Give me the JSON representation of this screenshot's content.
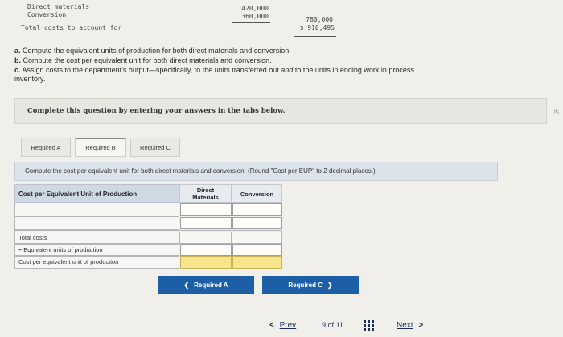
{
  "cost_summary": {
    "direct_materials_label": "Direct materials",
    "direct_materials_value": "420,000",
    "conversion_label": "Conversion",
    "conversion_value": "360,000",
    "subtotal_value": "780,000",
    "total_label": "Total costs to account for",
    "total_value": "$ 910,495"
  },
  "instructions": {
    "a_prefix": "a.",
    "a_text": "Compute the equivalent units of production for both direct materials and conversion.",
    "b_prefix": "b.",
    "b_text": "Compute the cost per equivalent unit for both direct materials and conversion.",
    "c_prefix": "c.",
    "c_text_1": "Assign costs to the department's output—specifically, to the units transferred out",
    "c_and": "and",
    "c_text_2": "to the units in ending work in process",
    "c_text_3": "inventory."
  },
  "complete_text": "Complete this question by entering your answers in the tabs below.",
  "tabs": [
    {
      "label": "Required A"
    },
    {
      "label": "Required B"
    },
    {
      "label": "Required C"
    }
  ],
  "question_text": "Compute the cost per equivalent unit for both direct materials and conversion. (Round \"Cost per EUP\" to 2 decimal places.)",
  "table": {
    "header_title": "Cost per Equivalent Unit of Production",
    "col1_line1": "Direct",
    "col1_line2": "Materials",
    "col2": "Conversion",
    "row_total_costs": "Total costs",
    "row_equiv_units": "÷ Equivalent units of production",
    "row_cost_per": "Cost per equivalent unit of production"
  },
  "nav": {
    "prev_label": "Required A",
    "next_label": "Required C"
  },
  "pager": {
    "prev": "Prev",
    "page_num": "9",
    "page_of": "of",
    "page_total": "11",
    "next": "Next"
  },
  "colors": {
    "accent": "#1c5fa6",
    "highlight": "#f6e58a"
  }
}
